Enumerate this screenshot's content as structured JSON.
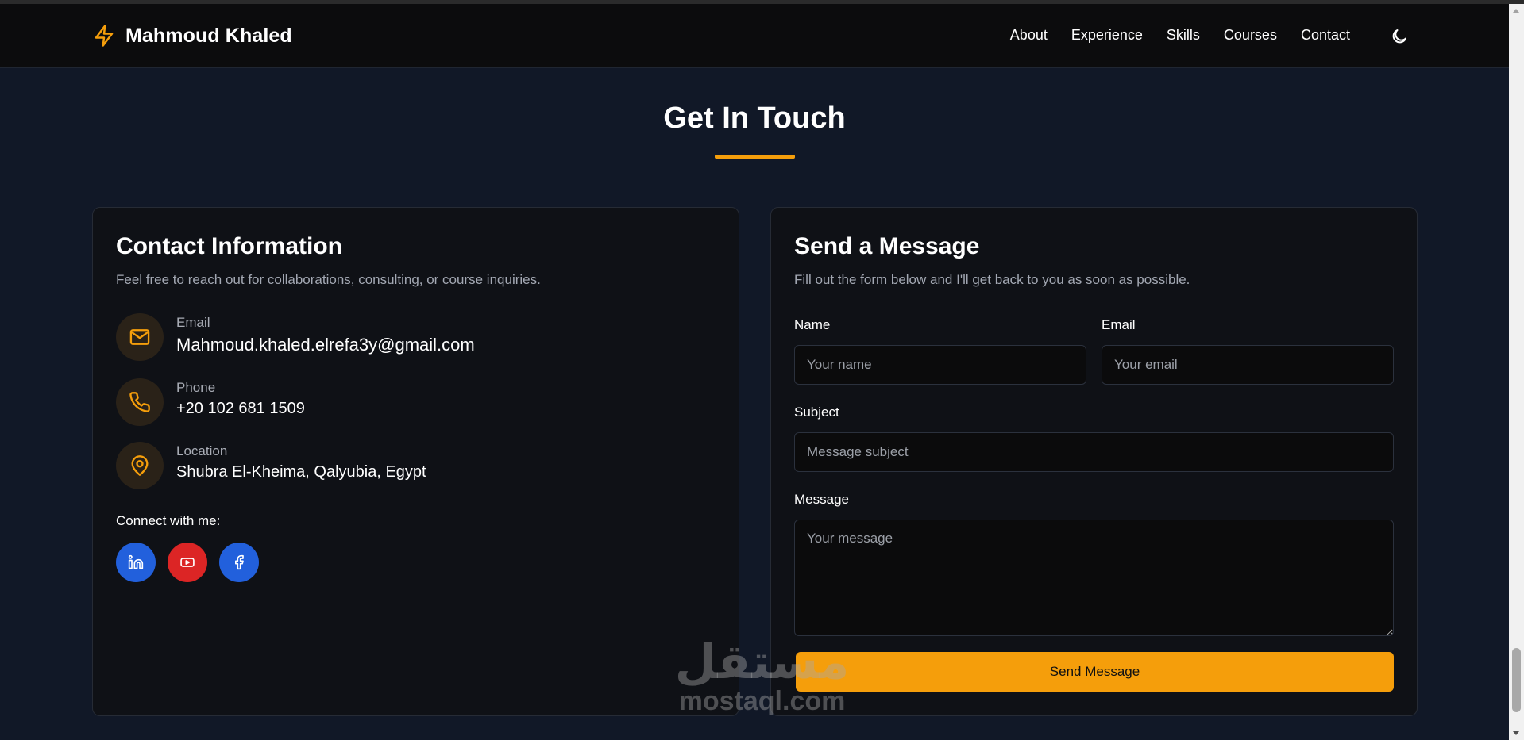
{
  "brand": {
    "name": "Mahmoud Khaled",
    "icon": "bolt-icon",
    "accent": "#f59e0b"
  },
  "nav": {
    "links": [
      "About",
      "Experience",
      "Skills",
      "Courses",
      "Contact"
    ],
    "theme_icon": "moon-icon"
  },
  "section": {
    "title": "Get In Touch"
  },
  "contact_info": {
    "title": "Contact Information",
    "subtitle": "Feel free to reach out for collaborations, consulting, or course inquiries.",
    "items": [
      {
        "label": "Email",
        "value": "Mahmoud.khaled.elrefa3y@gmail.com",
        "icon": "mail-icon"
      },
      {
        "label": "Phone",
        "value": "+20 102 681 1509",
        "icon": "phone-icon"
      },
      {
        "label": "Location",
        "value": "Shubra El-Kheima, Qalyubia, Egypt",
        "icon": "map-pin-icon"
      }
    ],
    "connect_label": "Connect with me:",
    "socials": [
      {
        "icon": "linkedin-icon",
        "color": "#2260dc"
      },
      {
        "icon": "youtube-icon",
        "color": "#dc2525"
      },
      {
        "icon": "facebook-icon",
        "color": "#2260dc"
      }
    ]
  },
  "form": {
    "title": "Send a Message",
    "subtitle": "Fill out the form below and I'll get back to you as soon as possible.",
    "name_label": "Name",
    "name_placeholder": "Your name",
    "email_label": "Email",
    "email_placeholder": "Your email",
    "subject_label": "Subject",
    "subject_placeholder": "Message subject",
    "message_label": "Message",
    "message_placeholder": "Your message",
    "submit_label": "Send Message"
  },
  "watermark": {
    "arabic": "مستقل",
    "latin": "mostaql.com"
  }
}
